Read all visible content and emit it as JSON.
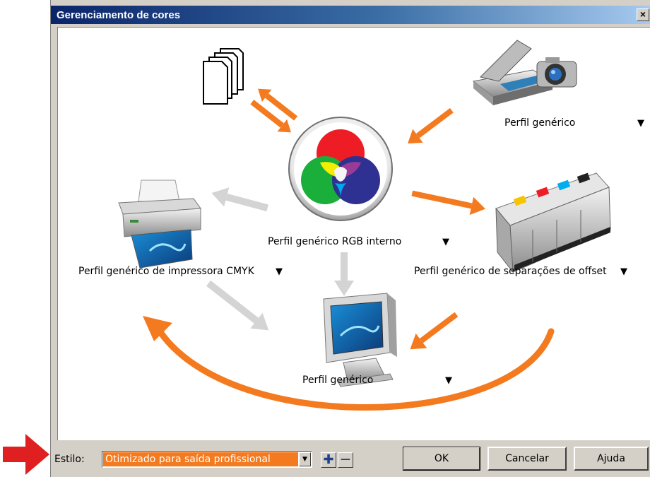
{
  "window": {
    "title": "Gerenciamento de cores",
    "close_glyph": "×"
  },
  "colors": {
    "orange": "#f47a20",
    "grey_arrow": "#d4d4d4",
    "red_arrow": "#e02020",
    "title_blue": "#0a246a"
  },
  "diagram": {
    "center_label": "Perfil genérico RGB interno",
    "scanner_label": "Perfil genérico",
    "printer_label": "Perfil genérico de impressora CMYK",
    "press_label": "Perfil genérico de separações de offset",
    "monitor_label": "Perfil genérico",
    "dropdown_glyph": "▼",
    "icons": [
      "documents-icon",
      "scanner-camera-icon",
      "rgb-color-wheel-icon",
      "inkjet-printer-icon",
      "offset-press-icon",
      "monitor-icon"
    ]
  },
  "footer": {
    "style_label": "Estilo:",
    "style_value": "Otimizado para saída profissional",
    "select_arrow": "▼",
    "add_glyph": "✚",
    "remove_glyph": "—",
    "ok": "OK",
    "cancel": "Cancelar",
    "help": "Ajuda"
  }
}
